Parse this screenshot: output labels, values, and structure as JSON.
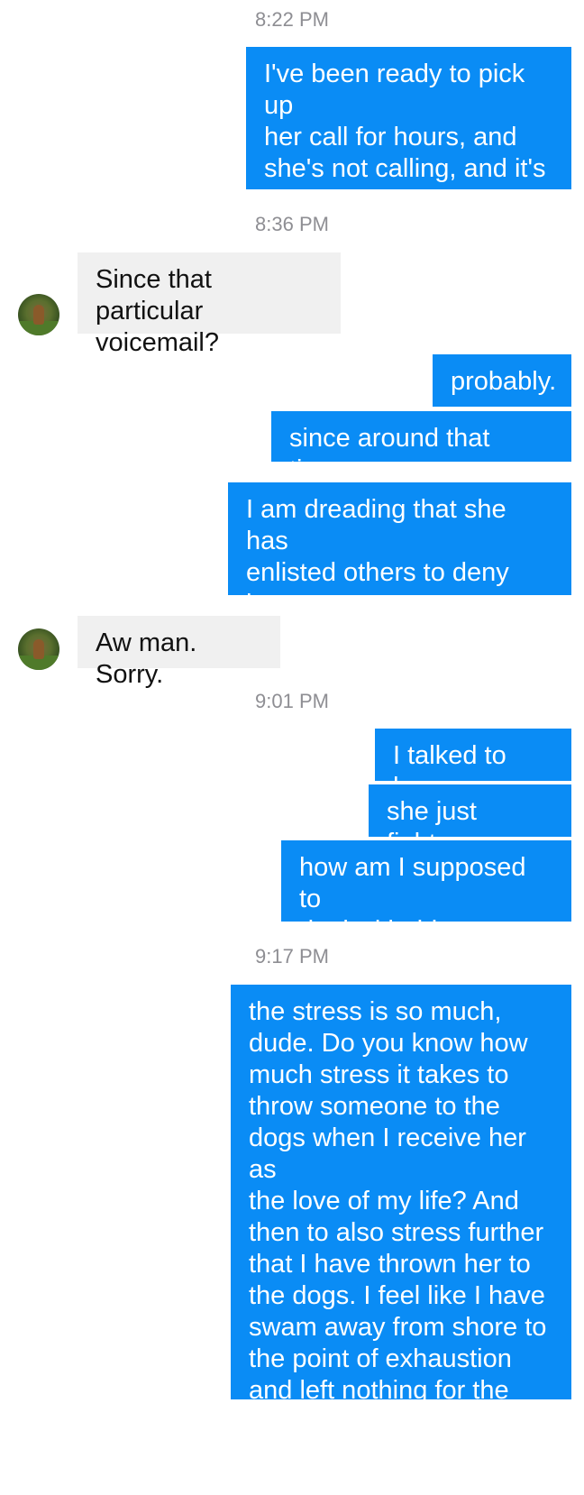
{
  "conversation": {
    "timestamps": [
      "8:22 PM",
      "8:36 PM",
      "9:01 PM",
      "9:17 PM"
    ],
    "messages": [
      {
        "from": "me",
        "text": "I've been ready to pick up\nher call for hours, and\nshe's not calling, and it's\ndriving me crazy."
      },
      {
        "from": "them",
        "text": "Since that particular\nvoicemail?"
      },
      {
        "from": "me",
        "text": "probably."
      },
      {
        "from": "me",
        "text": "since around that time."
      },
      {
        "from": "me",
        "text": "I am dreading that she has\nenlisted others to deny her\ncalls."
      },
      {
        "from": "them",
        "text": "Aw man. Sorry."
      },
      {
        "from": "me",
        "text": "I talked to her."
      },
      {
        "from": "me",
        "text": "she just fights."
      },
      {
        "from": "me",
        "text": "how am I supposed to\ndeal with this."
      },
      {
        "from": "me",
        "text": "the stress is so much,\ndude. Do you know how\nmuch stress it takes to\nthrow someone to the\ndogs when I receive her as\nthe love of my life? And\nthen to also stress further\nthat I have thrown her to\nthe dogs. I feel like I have\nswam away from shore to\nthe point of exhaustion\nand left nothing for the\nway back."
      }
    ]
  },
  "colors": {
    "outgoing_bubble": "#0a8cf5",
    "incoming_bubble": "#f0f0f0",
    "timestamp_text": "#8e8e93"
  },
  "icons": {
    "contact_avatar": "avatar-icon"
  }
}
